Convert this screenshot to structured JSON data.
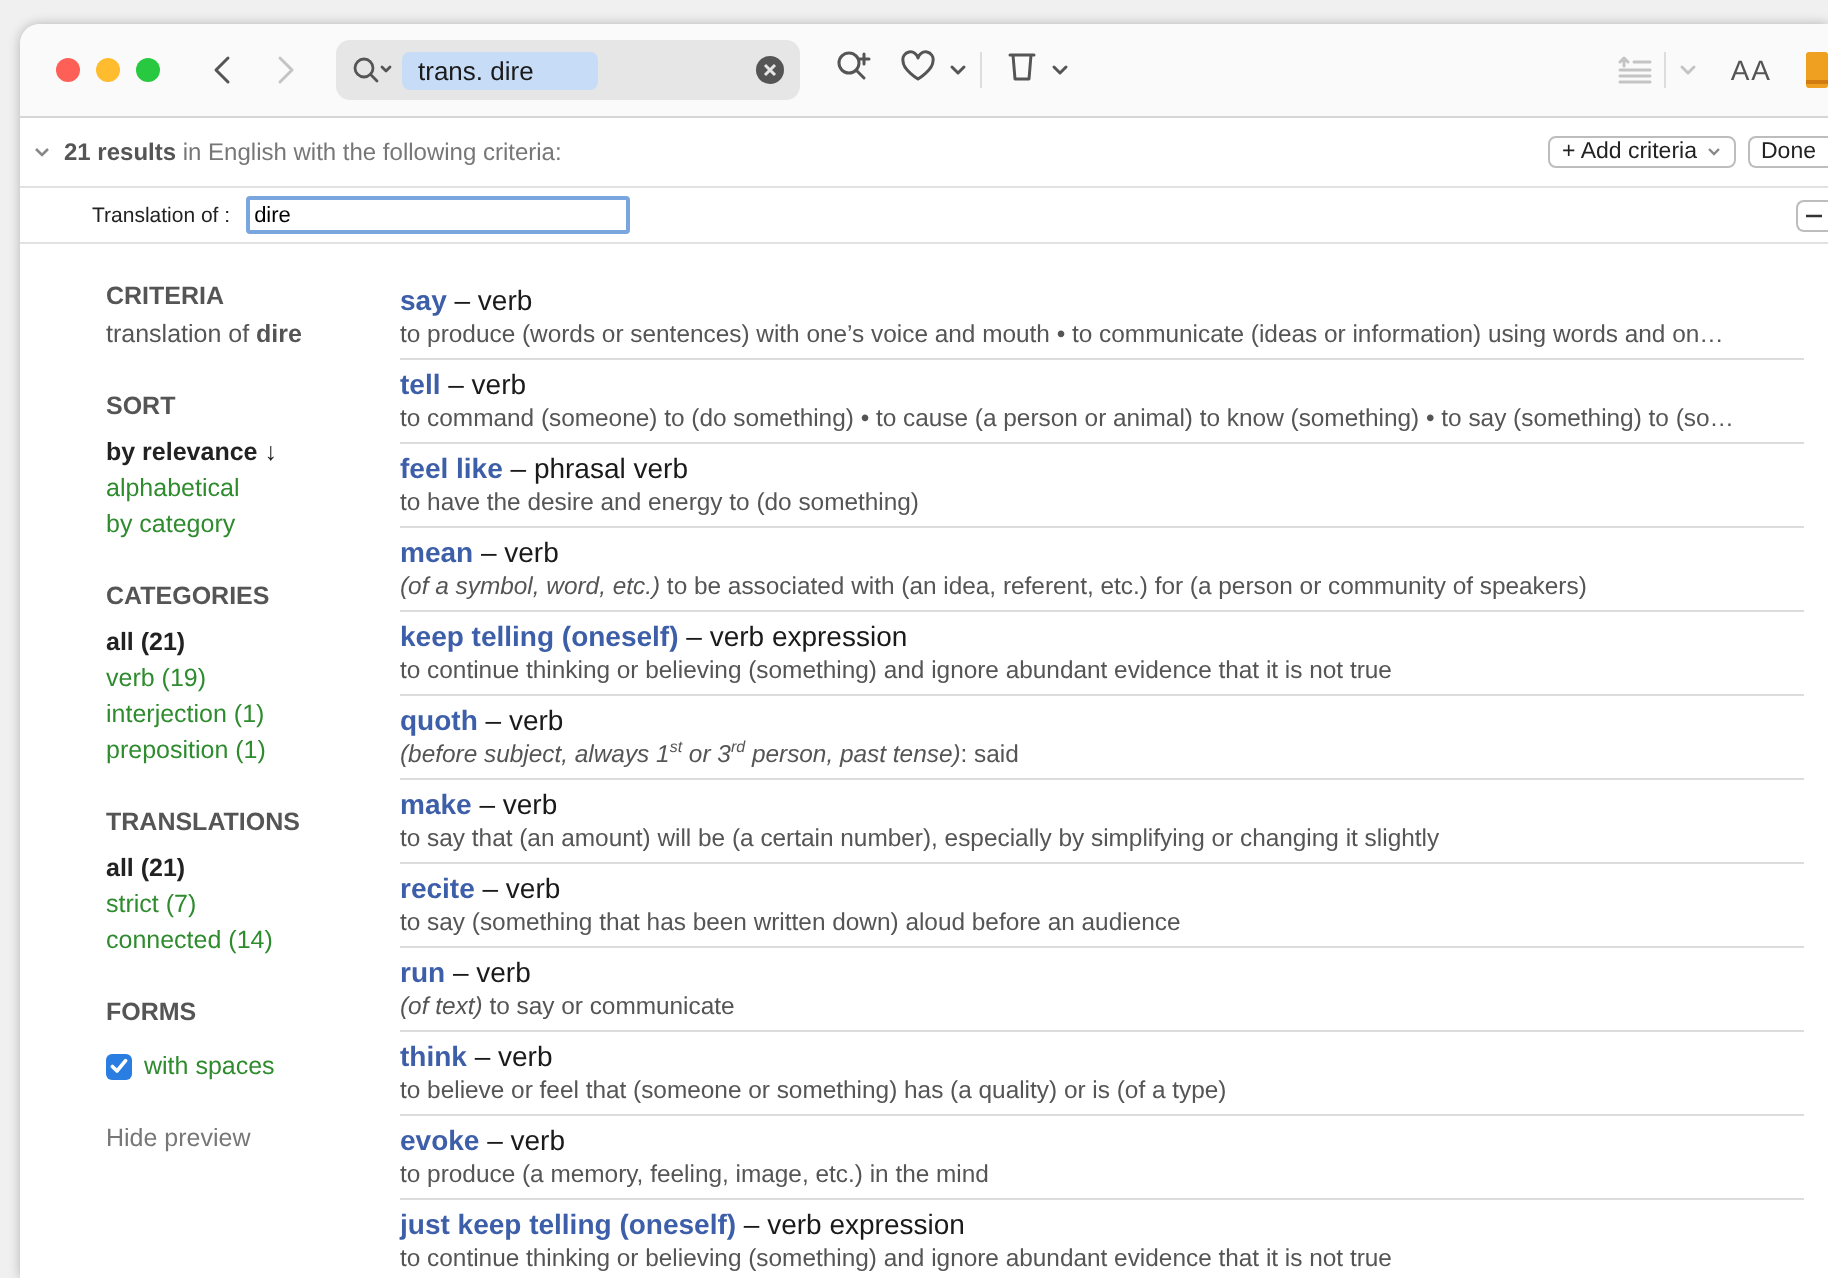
{
  "toolbar": {
    "search_token": "trans. dire",
    "back_disabled": false,
    "forward_disabled": true,
    "font_button": "AA"
  },
  "results_bar": {
    "expanded": true,
    "summary": "**21 results** in English with the following criteria:",
    "add_criteria": "+ Add criteria",
    "done": "Done"
  },
  "criteria_row": {
    "label": "Translation of :",
    "value": "dire"
  },
  "sidebar": [
    {
      "heading": "CRITERIA",
      "items": [
        {
          "kind": "text",
          "text": "translation of **dire**"
        }
      ]
    },
    {
      "heading": "SORT",
      "items": [
        {
          "kind": "option",
          "text": "by relevance ↓",
          "selected": true
        },
        {
          "kind": "option",
          "text": "alphabetical",
          "selected": false
        },
        {
          "kind": "option",
          "text": "by category",
          "selected": false
        }
      ]
    },
    {
      "heading": "CATEGORIES",
      "items": [
        {
          "kind": "option",
          "text": "all (21)",
          "selected": true
        },
        {
          "kind": "option",
          "text": "verb (19)",
          "selected": false
        },
        {
          "kind": "option",
          "text": "interjection (1)",
          "selected": false
        },
        {
          "kind": "option",
          "text": "preposition (1)",
          "selected": false
        }
      ]
    },
    {
      "heading": "TRANSLATIONS",
      "items": [
        {
          "kind": "option",
          "text": "all (21)",
          "selected": true
        },
        {
          "kind": "option",
          "text": "strict (7)",
          "selected": false
        },
        {
          "kind": "option",
          "text": "connected (14)",
          "selected": false
        }
      ]
    },
    {
      "heading": "FORMS",
      "items": [
        {
          "kind": "checkbox",
          "text": "with spaces",
          "checked": true
        }
      ]
    }
  ],
  "hide_preview": "Hide preview",
  "results": [
    {
      "word": "say",
      "pos": "– verb",
      "definition": "to produce (words or sentences) with one’s voice and mouth • to communicate (ideas or information) using words and on…"
    },
    {
      "word": "tell",
      "pos": "– verb",
      "definition": "to command (someone) to (do something) • to cause (a person or animal) to know (something) • to say (something) to (so…"
    },
    {
      "word": "feel like",
      "pos": "– phrasal verb",
      "definition": "to have the desire and energy to (do something)"
    },
    {
      "word": "mean",
      "pos": "– verb",
      "definition": "*(of a symbol, word, etc.)* to be associated with (an idea, referent, etc.) for (a person or community of speakers)"
    },
    {
      "word": "keep telling (oneself)",
      "pos": "– verb expression",
      "definition": "to continue thinking or believing (something) and ignore abundant evidence that it is not true"
    },
    {
      "word": "quoth",
      "pos": "– verb",
      "definition": "*(before subject, always 1$^{st}$ or 3$^{rd}$ person, past tense)*: said"
    },
    {
      "word": "make",
      "pos": "– verb",
      "definition": "to say that (an amount) will be (a certain number), especially by simplifying or changing it slightly"
    },
    {
      "word": "recite",
      "pos": "– verb",
      "definition": "to say (something that has been written down) aloud before an audience"
    },
    {
      "word": "run",
      "pos": "– verb",
      "definition": "*(of text)* to say or communicate"
    },
    {
      "word": "think",
      "pos": "– verb",
      "definition": "to believe or feel that (someone or something) has (a quality) or is (of a type)"
    },
    {
      "word": "evoke",
      "pos": "– verb",
      "definition": "to produce (a memory, feeling, image, etc.) in the mind"
    },
    {
      "word": "just keep telling (oneself)",
      "pos": "– verb expression",
      "definition": "to continue thinking or believing (something) and ignore abundant evidence that it is not true"
    }
  ]
}
